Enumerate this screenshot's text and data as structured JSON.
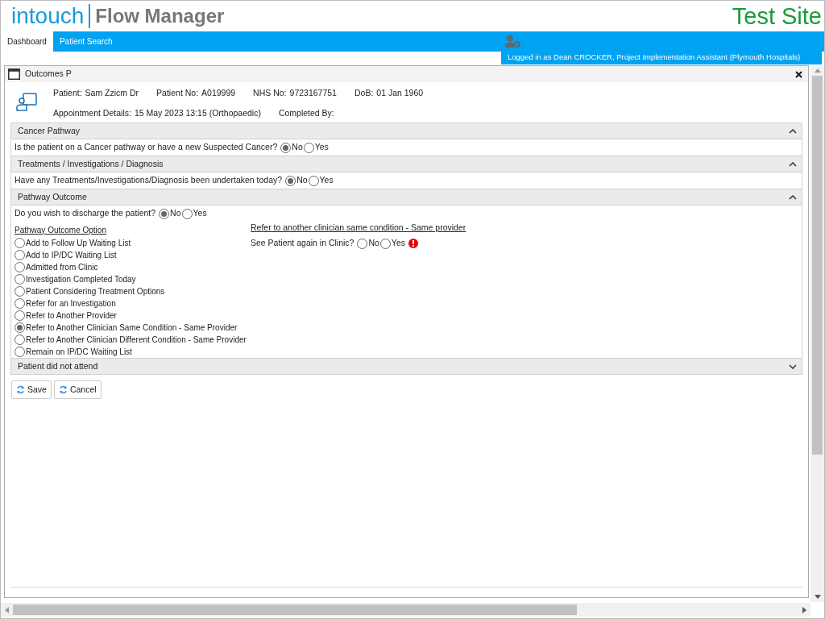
{
  "header": {
    "logo": {
      "brand": "intouch",
      "product": "Flow Manager"
    },
    "site_label": "Test Site"
  },
  "nav": {
    "tabs": [
      {
        "label": "Dashboard",
        "selected": true
      },
      {
        "label": "Patient Search",
        "selected": false
      }
    ],
    "logged_in": "Logged in as Dean CROCKER, Project Implementation Assistant (Plymouth Hospitals)"
  },
  "dialog": {
    "title": "Outcomes P",
    "patient_row_1": [
      {
        "label": "Patient:",
        "value": "Sam Zzicm Dr"
      },
      {
        "label": "Patient No:",
        "value": "A019999"
      },
      {
        "label": "NHS No:",
        "value": "9723167751"
      },
      {
        "label": "DoB:",
        "value": "01 Jan 1960"
      }
    ],
    "patient_row_2": [
      {
        "label": "Appointment Details:",
        "value": "15 May 2023 13:15 (Orthopaedic)"
      },
      {
        "label": "Completed By:"
      }
    ],
    "sections": [
      {
        "title": "Cancer Pathway",
        "expanded": true,
        "questions": [
          {
            "text": "Is the patient on a Cancer pathway or have a new Suspected Cancer?",
            "options": [
              {
                "label": "No",
                "selected": true
              },
              {
                "label": "Yes",
                "selected": false
              }
            ]
          }
        ]
      },
      {
        "title": "Treatments / Investigations / Diagnosis",
        "expanded": true,
        "questions": [
          {
            "text": "Have any Treatments/Investigations/Diagnosis been undertaken today?",
            "options": [
              {
                "label": "No",
                "selected": true
              },
              {
                "label": "Yes",
                "selected": false
              }
            ]
          }
        ]
      },
      {
        "title": "Pathway Outcome",
        "expanded": true,
        "questions": [
          {
            "text": "Do you wish to discharge the patient?",
            "options": [
              {
                "label": "No",
                "selected": true
              },
              {
                "label": "Yes",
                "selected": false
              }
            ]
          }
        ],
        "outcome": {
          "heading": "Pathway Outcome Option",
          "options": [
            {
              "label": "Add to Follow Up Waiting List",
              "selected": false
            },
            {
              "label": "Add to IP/DC Waiting List",
              "selected": false
            },
            {
              "label": "Admitted from Clinic",
              "selected": false
            },
            {
              "label": "Investigation Completed Today",
              "selected": false
            },
            {
              "label": "Patient Considering Treatment Options",
              "selected": false
            },
            {
              "label": "Refer for an Investigation",
              "selected": false
            },
            {
              "label": "Refer to Another Provider",
              "selected": false
            },
            {
              "label": "Refer to Another Clinician Same Condition - Same Provider",
              "selected": true
            },
            {
              "label": "Refer to Another Clinician Different Condition - Same Provider",
              "selected": false
            },
            {
              "label": "Remain on IP/DC Waiting List",
              "selected": false
            }
          ]
        },
        "detail": {
          "heading": "Refer to another clinician same condition - Same provider",
          "question": {
            "text": "See Patient again in Clinic?",
            "required": true,
            "options": [
              {
                "label": "No",
                "selected": false
              },
              {
                "label": "Yes",
                "selected": false
              }
            ]
          }
        }
      },
      {
        "title": "Patient did not attend",
        "expanded": false
      }
    ],
    "buttons": [
      {
        "label": "Save"
      },
      {
        "label": "Cancel"
      }
    ]
  }
}
